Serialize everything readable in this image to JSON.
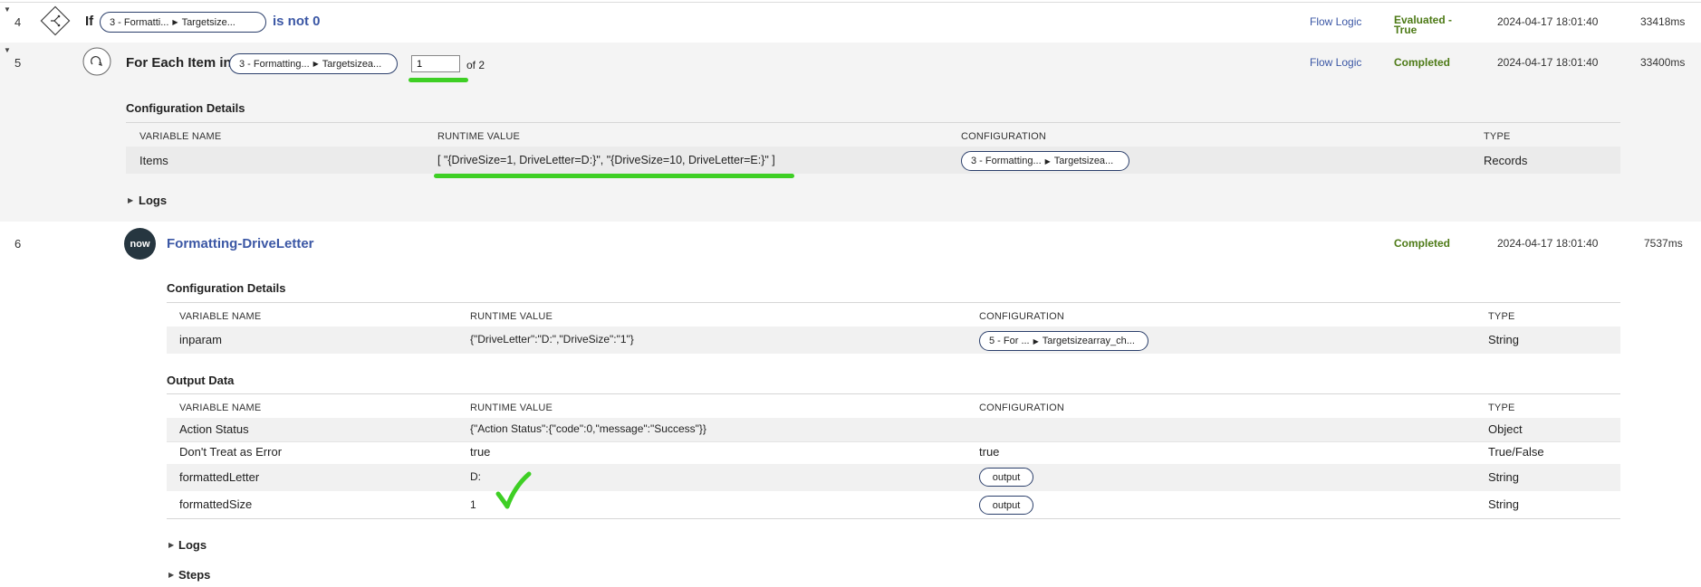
{
  "rows": {
    "r4": {
      "num": "4",
      "title": "If",
      "pill_step": "3 - Formatti...",
      "pill_field": "Targetsize...",
      "condition": "is not 0",
      "category": "Flow Logic",
      "status": "Evaluated - True",
      "timestamp": "2024-04-17 18:01:40",
      "duration": "33418ms"
    },
    "r5": {
      "num": "5",
      "title": "For Each Item in",
      "pill_step": "3 - Formatting...",
      "pill_field": "Targetsizea...",
      "iteration_value": "1",
      "of_label": "of 2",
      "category": "Flow Logic",
      "status": "Completed",
      "timestamp": "2024-04-17 18:01:40",
      "duration": "33400ms",
      "config_title": "Configuration Details",
      "headers": [
        "VARIABLE NAME",
        "RUNTIME VALUE",
        "CONFIGURATION",
        "TYPE"
      ],
      "items": {
        "name": "Items",
        "runtime": "[ \"{DriveSize=1, DriveLetter=D:}\", \"{DriveSize=10, DriveLetter=E:}\" ]",
        "pill_step": "3 - Formatting...",
        "pill_field": "Targetsizea...",
        "type": "Records"
      },
      "logs_label": "Logs"
    },
    "r6": {
      "num": "6",
      "avatar_text": "now",
      "title": "Formatting-DriveLetter",
      "status": "Completed",
      "timestamp": "2024-04-17 18:01:40",
      "duration": "7537ms",
      "config_title": "Configuration Details",
      "headers": [
        "VARIABLE NAME",
        "RUNTIME VALUE",
        "CONFIGURATION",
        "TYPE"
      ],
      "inparam": {
        "name": "inparam",
        "runtime": "{\"DriveLetter\":\"D:\",\"DriveSize\":\"1\"}",
        "pill_step": "5 - For ...",
        "pill_field": "Targetsizearray_ch...",
        "type": "String"
      },
      "output_title": "Output Data",
      "output_headers": [
        "VARIABLE NAME",
        "RUNTIME VALUE",
        "CONFIGURATION",
        "TYPE"
      ],
      "outputs": [
        {
          "name": "Action Status",
          "runtime": "{\"Action Status\":{\"code\":0,\"message\":\"Success\"}}",
          "config": "",
          "type": "Object"
        },
        {
          "name": "Don't Treat as Error",
          "runtime": "true",
          "config": "true",
          "type": "True/False"
        },
        {
          "name": "formattedLetter",
          "runtime": "D:",
          "config": "output",
          "type": "String"
        },
        {
          "name": "formattedSize",
          "runtime": "1",
          "config": "output",
          "type": "String"
        }
      ],
      "logs_label": "Logs",
      "steps_label": "Steps"
    }
  },
  "colors": {
    "accent_green": "#3ecf24",
    "status_green": "#4d7a16",
    "link_blue": "#3b57a5",
    "band_grey": "#f4f4f4"
  }
}
